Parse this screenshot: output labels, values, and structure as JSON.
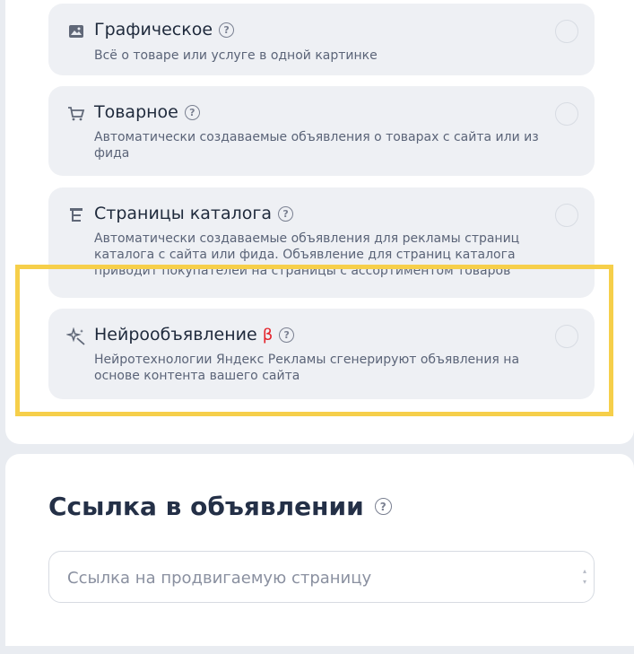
{
  "ad_types": [
    {
      "title": "Графическое",
      "description": "Всё о товаре или услуге в одной картинке",
      "icon": "image-icon"
    },
    {
      "title": "Товарное",
      "description": "Автоматически создаваемые объявления о товарах с сайта или из фида",
      "icon": "cart-icon"
    },
    {
      "title": "Страницы каталога",
      "description": "Автоматически создаваемые объявления для рекламы страниц каталога с сайта или фида. Объявление для страниц каталога приводит покупателей на страницы с ассортиментом товаров",
      "icon": "catalog-tree-icon"
    },
    {
      "title": "Нейрообъявление",
      "badge": "β",
      "description": "Нейротехнологии Яндекс Рекламы сгенерируют объявления на основе контента вашего сайта",
      "icon": "magic-sparkle-icon"
    }
  ],
  "link_section": {
    "title": "Ссылка в объявлении",
    "input_placeholder": "Ссылка на продвигаемую страницу",
    "input_value": ""
  },
  "help_glyph": "?",
  "colors": {
    "background": "#e9ecf1",
    "card": "#eef0f4",
    "highlight": "#f6cf4a",
    "beta": "#e4232b"
  }
}
